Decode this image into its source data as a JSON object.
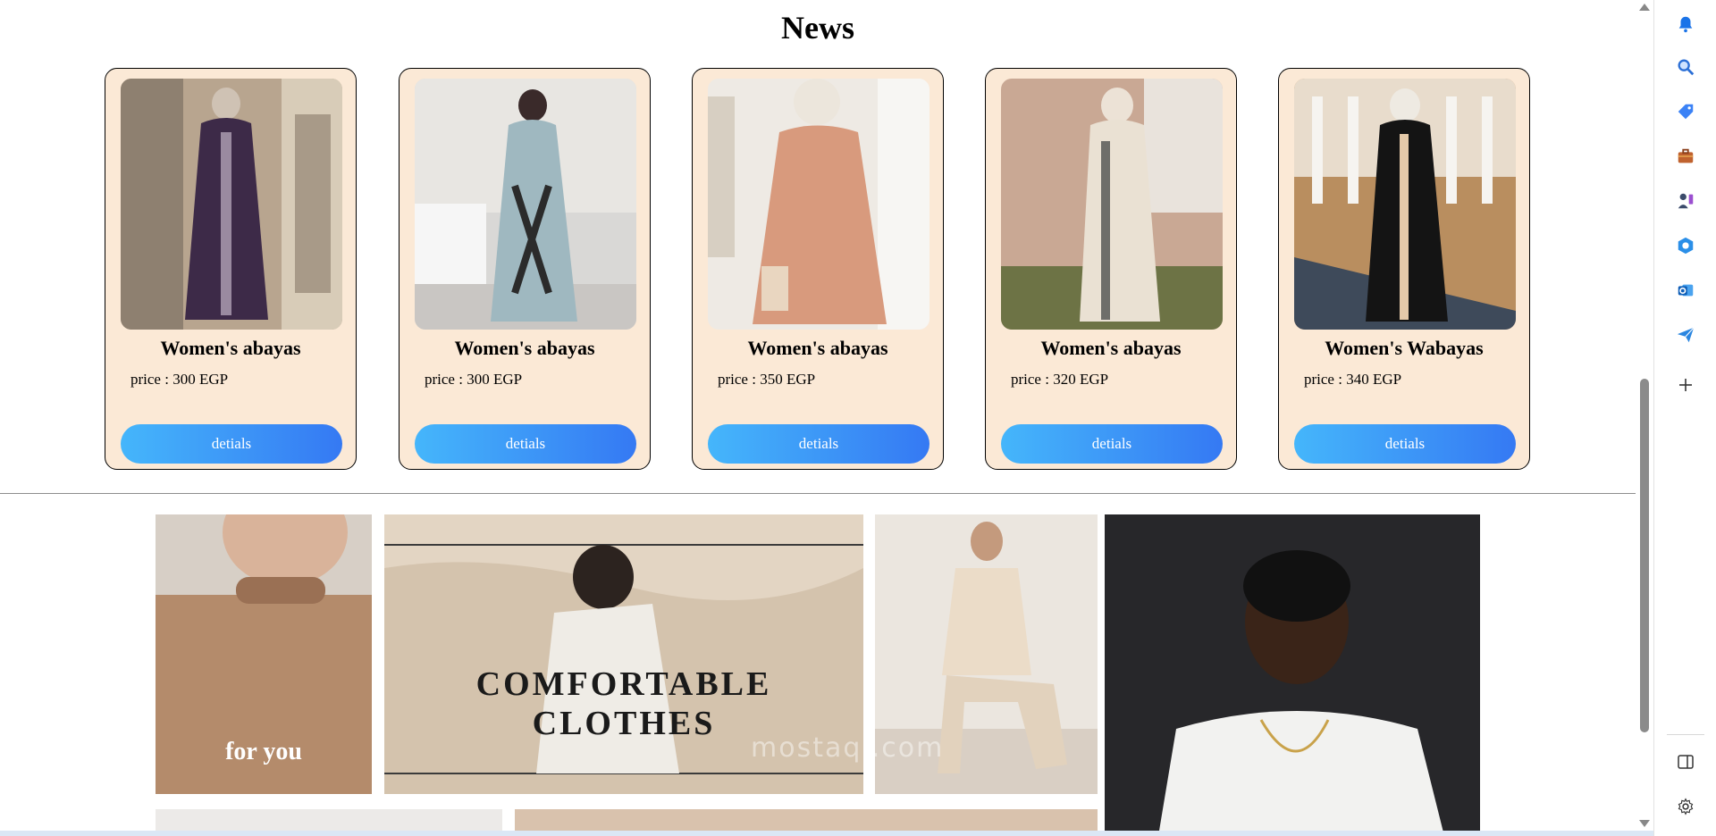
{
  "section": {
    "title": "News"
  },
  "products": [
    {
      "name": "Women's abayas",
      "price": "price : 300 EGP",
      "button": "detials"
    },
    {
      "name": "Women's abayas",
      "price": "price : 300 EGP",
      "button": "detials"
    },
    {
      "name": "Women's abayas",
      "price": "price : 350 EGP",
      "button": "detials"
    },
    {
      "name": "Women's abayas",
      "price": "price : 320 EGP",
      "button": "detials"
    },
    {
      "name": "Women's Wabayas",
      "price": "price : 340 EGP",
      "button": "detials"
    }
  ],
  "banner": {
    "headline_line1": "COMFORTABLE",
    "headline_line2": "CLOTHES",
    "tagline": "for you",
    "watermark": "mostaql.com"
  },
  "sidebar_icons": [
    "bell-icon",
    "search-icon",
    "tag-icon",
    "briefcase-icon",
    "games-icon",
    "copilot-icon",
    "outlook-icon",
    "send-icon",
    "plus-icon",
    "split-view-icon",
    "settings-icon"
  ],
  "colors": {
    "card_bg": "#fbe9d6",
    "button_start": "#45b6fb",
    "button_end": "#3579f3"
  }
}
